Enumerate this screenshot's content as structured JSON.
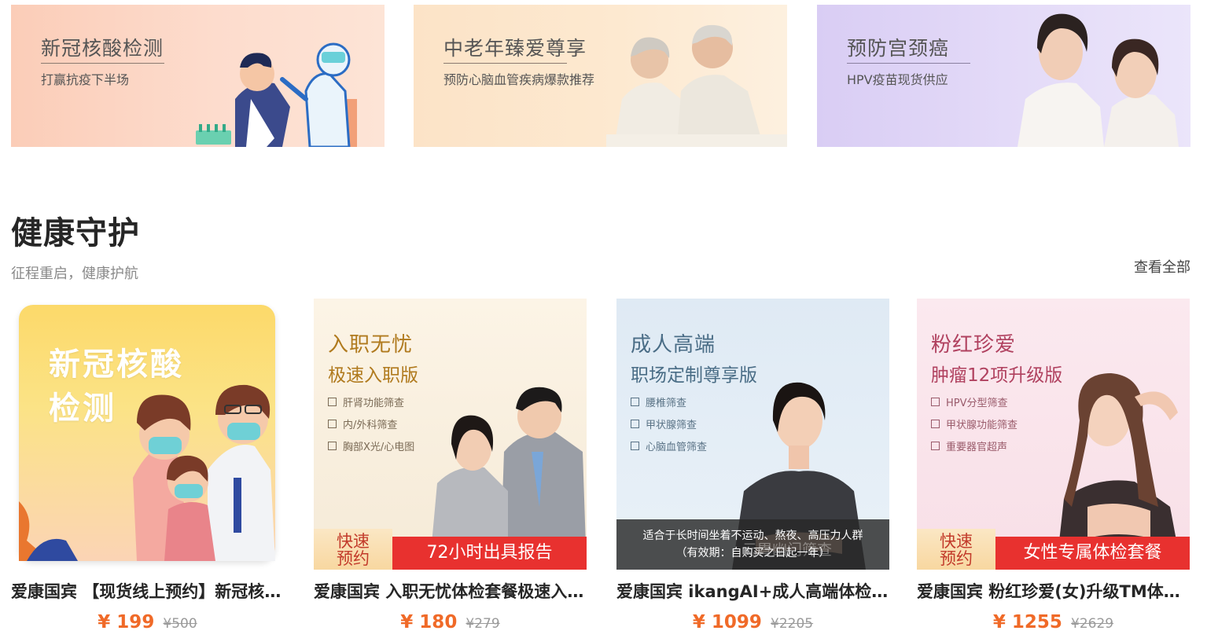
{
  "banners": [
    {
      "title": "新冠核酸检测",
      "subtitle": "打赢抗疫下半场"
    },
    {
      "title": "中老年臻爱尊享",
      "subtitle": "预防心脑血管疾病爆款推荐"
    },
    {
      "title": "预防宫颈癌",
      "subtitle": "HPV疫苗现货供应"
    }
  ],
  "section": {
    "title": "健康守护",
    "subtitle": "征程重启，健康护航",
    "view_all": "查看全部"
  },
  "products": [
    {
      "image_text": "新冠核酸\n检测",
      "image_line1": "新冠核酸",
      "image_line2": "检测",
      "title": "爱康国宾 【现货线上预约】新冠核酸检测",
      "price": "¥ 199",
      "old_price": "¥500"
    },
    {
      "image_title": "入职无忧",
      "image_subtitle": "极速入职版",
      "features": [
        "肝肾功能筛查",
        "内/外科筛查",
        "胸部X光/心电图"
      ],
      "badge_fast_1": "快速",
      "badge_fast_2": "预约",
      "badge_red": "72小时出具报告",
      "title": "爱康国宾 入职无忧体检套餐极速入职版",
      "price": "¥ 180",
      "old_price": "¥279"
    },
    {
      "image_title": "成人高端",
      "image_subtitle": "职场定制尊享版",
      "features": [
        "腰椎筛查",
        "甲状腺筛查",
        "心脑血管筛查"
      ],
      "overlay_line1": "适合于长时间坐着不运动、熬夜、高压力人群",
      "overlay_line2": "（有效期：自购买之日起一年）",
      "overlay_ghost": "元胃幽门筛查",
      "title": "爱康国宾 ikangAI+成人高端体检套餐",
      "price": "¥ 1099",
      "old_price": "¥2205"
    },
    {
      "image_title": "粉红珍爱",
      "image_subtitle": "肿瘤12项升级版",
      "features": [
        "HPV分型筛查",
        "甲状腺功能筛查",
        "重要器官超声"
      ],
      "badge_fast_1": "快速",
      "badge_fast_2": "预约",
      "badge_red": "女性专属体检套餐",
      "title": "爱康国宾 粉红珍爱(女)升级TM体检套餐",
      "price": "¥ 1255",
      "old_price": "¥2629"
    }
  ]
}
